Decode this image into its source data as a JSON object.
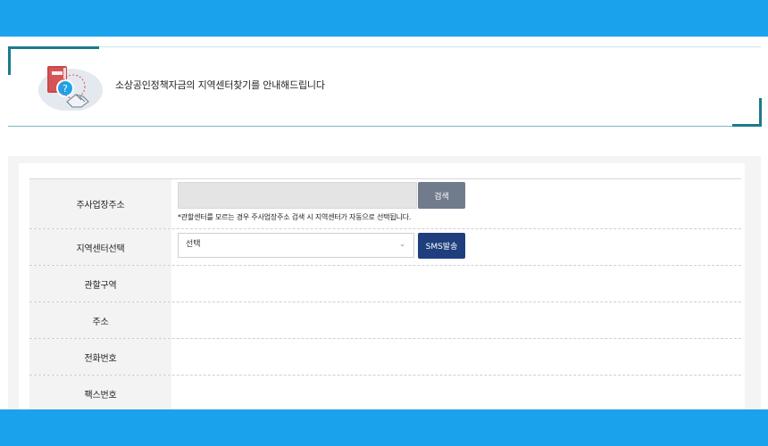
{
  "intro": {
    "text": "소상공인정책자금의 지역센터찾기를 안내해드립니다",
    "icon": "book-handshake-icon"
  },
  "form": {
    "address": {
      "label": "주사업장주소",
      "value": "",
      "search_label": "검색",
      "note": "*관할센터를 모르는 경우 주사업장주소 검색 시 지역센터가 자동으로 선택됩니다."
    },
    "center": {
      "label": "지역센터선택",
      "selected": "선택",
      "sms_label": "SMS발송"
    },
    "rows": [
      {
        "label": "관할구역",
        "value": ""
      },
      {
        "label": "주소",
        "value": ""
      },
      {
        "label": "전화번호",
        "value": ""
      },
      {
        "label": "팩스번호",
        "value": ""
      }
    ]
  },
  "colors": {
    "accent_bar": "#1aa3ec",
    "corner_accent": "#1a7b8a",
    "search_button": "#707b8c",
    "sms_button": "#1e3e7d"
  }
}
